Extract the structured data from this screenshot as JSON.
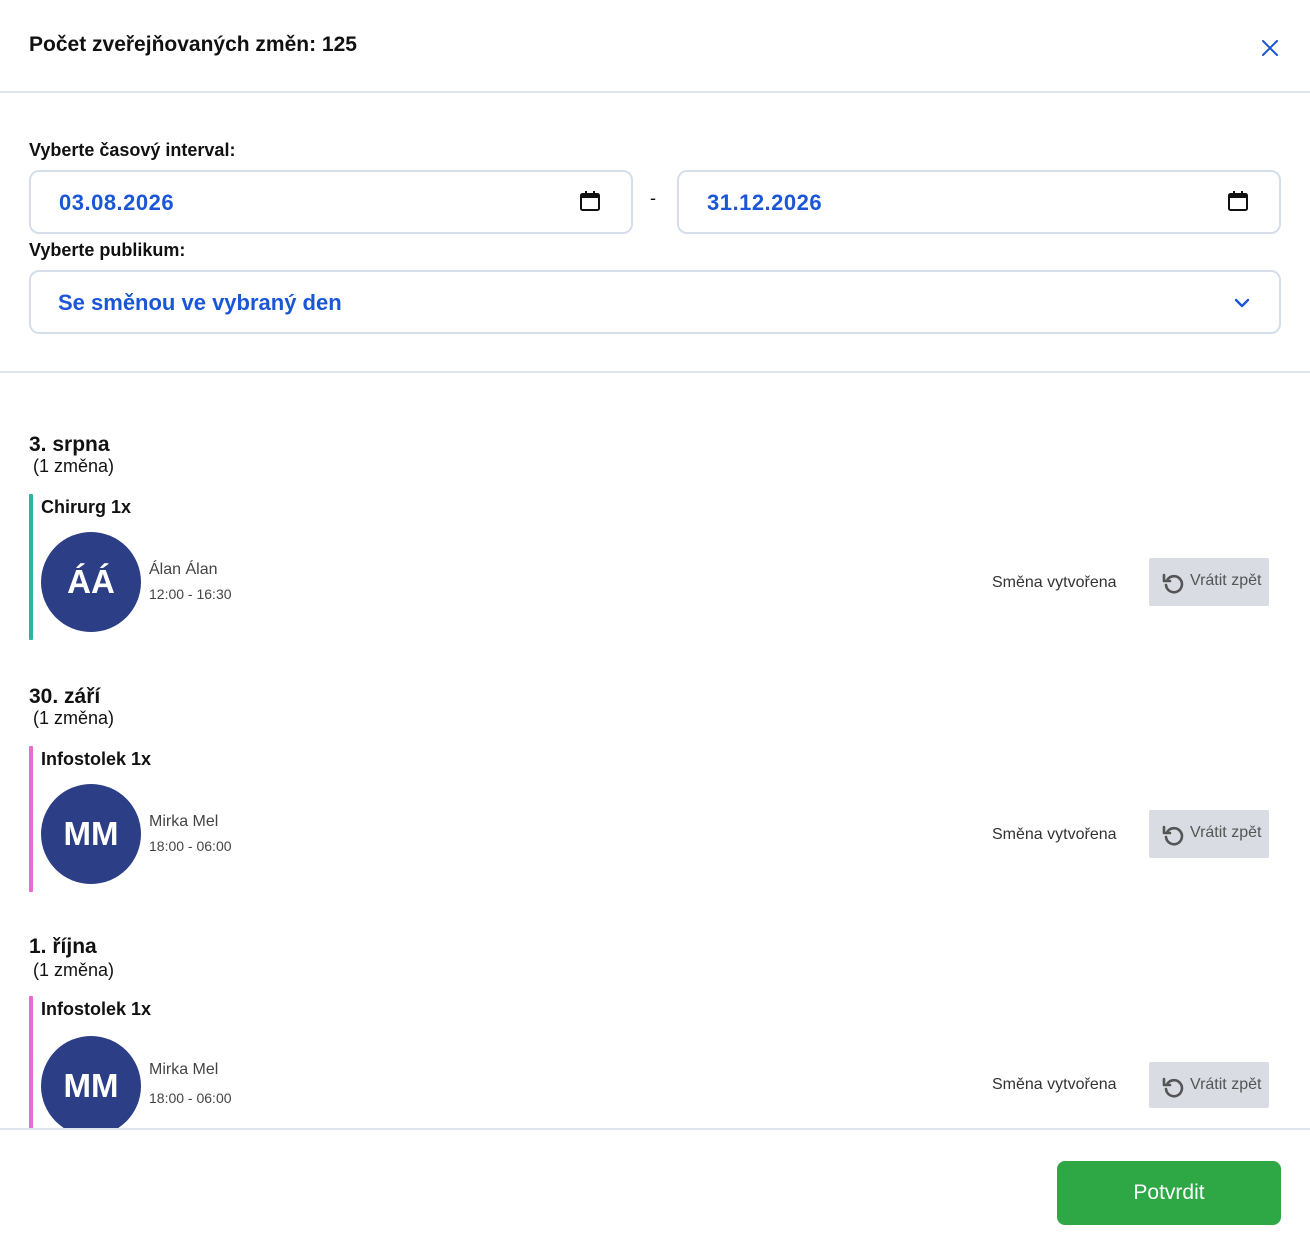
{
  "header": {
    "title": "Počet zveřejňovaných změn: 125",
    "close_icon": "close-icon"
  },
  "filters": {
    "interval_label": "Vyberte časový interval:",
    "date_from": "03.08.2026",
    "separator": "-",
    "date_to": "31.12.2026",
    "audience_label": "Vyberte publikum:",
    "audience_value": "Se směnou ve vybraný den"
  },
  "days": [
    {
      "title": "3. srpna",
      "count": "(1 změna)",
      "group": {
        "title": "Chirurg 1x",
        "color": "#2bb5a0",
        "initials": "ÁÁ",
        "name": "Álan Álan",
        "time": "12:00 - 16:30",
        "status": "Směna vytvořena",
        "undo_label": "Vrátit zpět"
      }
    },
    {
      "title": "30. září",
      "count": "(1 změna)",
      "group": {
        "title": "Infostolek 1x",
        "color": "#e96bd0",
        "initials": "MM",
        "name": "Mirka Mel",
        "time": "18:00 - 06:00",
        "status": "Směna vytvořena",
        "undo_label": "Vrátit zpět"
      }
    },
    {
      "title": "1. října",
      "count": "(1 změna)",
      "group": {
        "title": "Infostolek 1x",
        "color": "#e96bd0",
        "initials": "MM",
        "name": "Mirka Mel",
        "time": "18:00 - 06:00",
        "status": "Směna vytvořena",
        "undo_label": "Vrátit zpět"
      }
    }
  ],
  "footer": {
    "confirm_label": "Potvrdit"
  },
  "colors": {
    "accent_blue": "#1a56d6",
    "avatar_bg": "#2c3e86",
    "confirm_green": "#2ea845"
  }
}
